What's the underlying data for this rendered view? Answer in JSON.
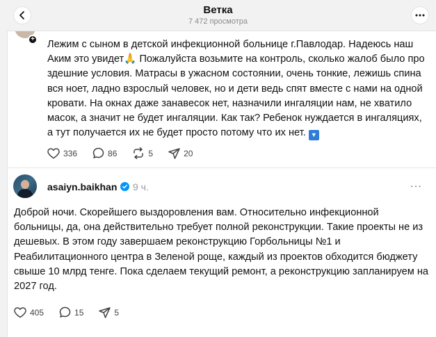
{
  "header": {
    "title": "Ветка",
    "views": "7 472 просмотра"
  },
  "previous_post": {
    "text_before_emoji": "Лежим с сыном в детской инфекционной больнице г.Павлодар. Надеюсь наш Аким это увидет",
    "emoji_pray": "🙏",
    "text_after_emoji": " Пожалуйста возьмите на контроль, сколько жалоб было про здешние условия. Матрасы в ужасном состоянии, очень тонкие, лежишь спина вся ноет, ладно взрослый человек, но и дети ведь спят вместе с нами на одной кровати. На окнах даже занавесок нет, назначили ингаляции нам, не хватило масок, а значит не будет ингаляции. Как так? Ребенок нуждается в ингаляциях, а тут получается их не будет просто потому что их нет. ",
    "emoji_down": "▼",
    "likes": "336",
    "comments": "86",
    "reposts": "5",
    "shares": "20"
  },
  "reply": {
    "username": "asaiyn.baikhan",
    "time": "9 ч.",
    "more": "···",
    "text": "Доброй ночи. Скорейшего выздоровления вам. Относительно инфекционной больницы, да, она действительно требует полной реконструкции. Такие проекты не из дешевых. В этом году завершаем реконструкцию Горбольницы №1 и Реабилитационного центра в Зеленой роще, каждый из проектов обходится бюджету свыше 10 млрд тенге. Пока сделаем текущий ремонт, а реконструкцию запланируем на 2027 год.",
    "likes": "405",
    "comments": "15",
    "shares": "5"
  },
  "icons": {
    "back": "arrow-left-icon",
    "more": "ellipsis-icon",
    "like": "heart-icon",
    "comment": "speech-bubble-icon",
    "repost": "repost-arrows-icon",
    "share": "paper-plane-icon",
    "verified": "verified-badge-icon"
  },
  "colors": {
    "background": "#f2f2f2",
    "card": "#ffffff",
    "text": "#101010",
    "muted": "#8a8a8a",
    "verified": "#0095f6"
  }
}
